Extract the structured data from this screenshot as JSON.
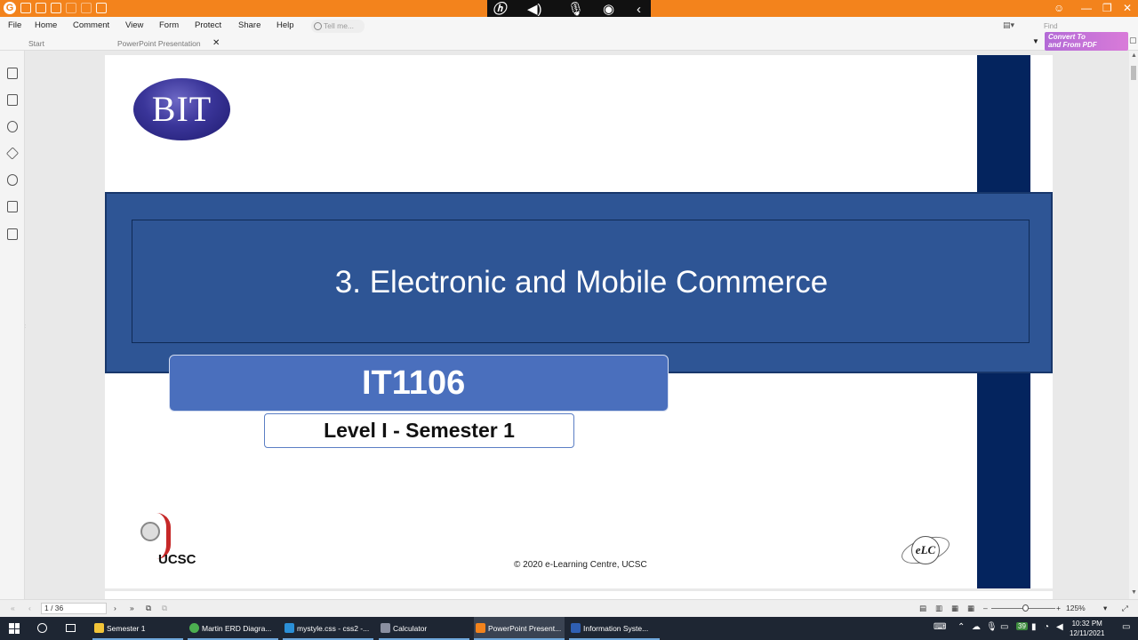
{
  "menu": {
    "items": [
      "File",
      "Home",
      "Comment",
      "View",
      "Form",
      "Protect",
      "Share",
      "Help"
    ],
    "tell_me_placeholder": "Tell me...",
    "find_placeholder": "Find"
  },
  "tabs": {
    "start": "Start",
    "document": "PowerPoint Presentation"
  },
  "convert_banner": {
    "line1": "Convert To",
    "line2": "and From PDF"
  },
  "slide": {
    "logo_text": "BIT",
    "title": "3. Electronic and Mobile Commerce",
    "course_code": "IT1106",
    "level": "Level I - Semester 1",
    "ucsc_label": "UCSC",
    "copyright": "© 2020 e-Learning Centre, UCSC",
    "elc_label": "eLC"
  },
  "status": {
    "page": "1 / 36",
    "zoom": "125%"
  },
  "taskbar": {
    "items": [
      {
        "label": "Semester 1",
        "color": "#f2c438"
      },
      {
        "label": "Martin ERD Diagra...",
        "color": "#4caf50"
      },
      {
        "label": "mystyle.css - css2 -...",
        "color": "#2b8fd6"
      },
      {
        "label": "Calculator",
        "color": "#8a8fa0"
      },
      {
        "label": "PowerPoint Present...",
        "color": "#f3831c"
      },
      {
        "label": "Information Syste...",
        "color": "#2f5fb3"
      }
    ],
    "clock_time": "10:32 PM",
    "clock_date": "12/11/2021",
    "notification_count": "39"
  },
  "colors": {
    "accent_orange": "#f3831c",
    "slide_band": "#2e5595",
    "navy_bar": "#04245e"
  }
}
